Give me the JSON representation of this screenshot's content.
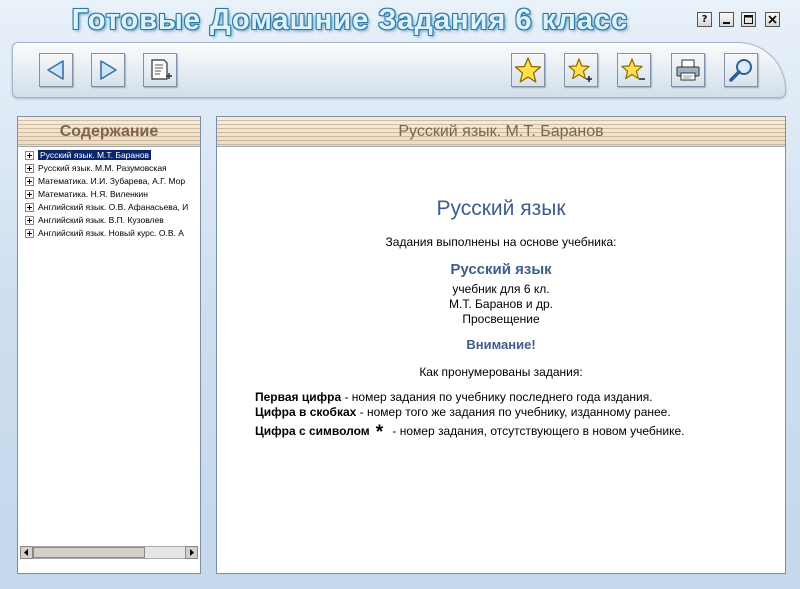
{
  "window": {
    "title": "Готовые Домашние Задания 6 класс",
    "controls": {
      "help": "?",
      "minimize": "_",
      "maximize": "□",
      "close": "✕"
    }
  },
  "toolbar": {
    "buttons": [
      {
        "name": "back",
        "icon": "arrow-left-icon"
      },
      {
        "name": "forward",
        "icon": "arrow-right-icon"
      },
      {
        "name": "notes",
        "icon": "note-add-icon"
      },
      {
        "name": "favorites",
        "icon": "star-icon"
      },
      {
        "name": "add-favorite",
        "icon": "star-plus-icon"
      },
      {
        "name": "remove-favorite",
        "icon": "star-minus-icon"
      },
      {
        "name": "print",
        "icon": "printer-icon"
      },
      {
        "name": "search",
        "icon": "magnifier-icon"
      }
    ]
  },
  "sidebar": {
    "title": "Содержание",
    "items": [
      {
        "label": "Русский язык. М.Т. Баранов",
        "selected": true
      },
      {
        "label": "Русский язык. М.М. Разумовская",
        "selected": false
      },
      {
        "label": "Математика. И.И. Зубарева, А.Г. Мор",
        "selected": false
      },
      {
        "label": "Математика. Н.Я. Виленкин",
        "selected": false
      },
      {
        "label": "Английский язык. О.В. Афанасьева, И",
        "selected": false
      },
      {
        "label": "Английский язык. В.П. Кузовлев",
        "selected": false
      },
      {
        "label": "Английский язык. Новый курс. О.В. А",
        "selected": false
      }
    ]
  },
  "content": {
    "title": "Русский язык. М.Т. Баранов",
    "heading": "Русский язык",
    "basis": "Задания выполнены на основе учебника:",
    "book": {
      "title": "Русский язык",
      "grade": "учебник для 6 кл.",
      "authors": "М.Т. Баранов и др.",
      "publisher": "Просвещение"
    },
    "attention": "Внимание!",
    "numbering_intro": "Как пронумерованы задания:",
    "legend": [
      {
        "term": "Первая цифра",
        "text": " - номер задания по учебнику последнего года издания."
      },
      {
        "term": "Цифра в скобках",
        "text": " - номер того же задания по учебнику, изданному ранее."
      },
      {
        "term": "Цифра с символом",
        "symbol": "*",
        "text": " - номер задания, отсутствующего в новом учебнике."
      }
    ]
  },
  "colors": {
    "accent": "#3d5e8c",
    "title_glow": "#2e84b0",
    "panel_header_text": "#806448"
  }
}
